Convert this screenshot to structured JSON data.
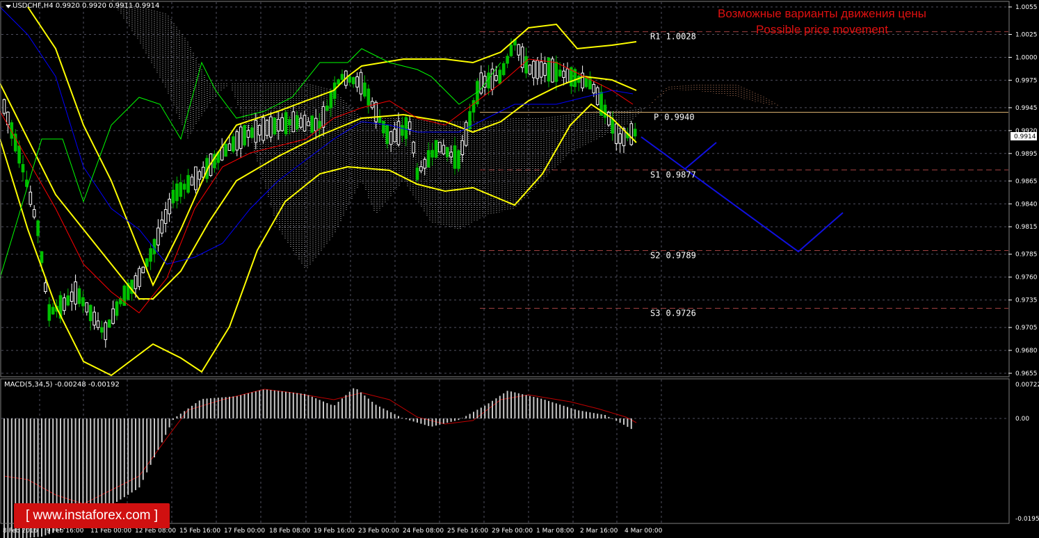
{
  "header": {
    "symbol_line": "USDCHF,H4  0.9920 0.9920 0.9911 0.9914",
    "macd_line": "MACD(5,34,5) -0.00248 -0.00192"
  },
  "annotation": {
    "line1": "Возможные варианты движения цены",
    "line2": "Possible price movement"
  },
  "watermark": "[ www.instaforex.com ]",
  "current_price": "0.9914",
  "price_axis": [
    "1.0055",
    "1.0025",
    "1.0000",
    "0.9975",
    "0.9945",
    "0.9920",
    "0.9895",
    "0.9865",
    "0.9840",
    "0.9815",
    "0.9785",
    "0.9760",
    "0.9735",
    "0.9705",
    "0.9680",
    "0.9655"
  ],
  "macd_axis": [
    "0.00722",
    "0.00",
    "-0.01951"
  ],
  "date_axis": [
    "8 Feb 2016",
    "9 Feb 16:00",
    "11 Feb 00:00",
    "12 Feb 08:00",
    "15 Feb 16:00",
    "17 Feb 00:00",
    "18 Feb 08:00",
    "19 Feb 16:00",
    "23 Feb 00:00",
    "24 Feb 08:00",
    "25 Feb 16:00",
    "29 Feb 00:00",
    "1 Mar 08:00",
    "2 Mar 16:00",
    "4 Mar 00:00"
  ],
  "pivots": [
    {
      "name": "R1",
      "value": "1.0028"
    },
    {
      "name": "P",
      "value": "0.9940"
    },
    {
      "name": "S1",
      "value": "0.9877"
    },
    {
      "name": "S2",
      "value": "0.9789"
    },
    {
      "name": "S3",
      "value": "0.9726"
    }
  ],
  "colors": {
    "bull": "#ffffff",
    "bear": "#00c000",
    "bollinger": "#ffff00",
    "kijun": "#0000ff",
    "tenkan": "#ff0000",
    "chikou": "#00ff00",
    "forecast": "#0000ff",
    "annotation": "#e01010",
    "grid": "#505060",
    "pivot": "#a04040",
    "pivot_p": "#d8b070"
  }
}
